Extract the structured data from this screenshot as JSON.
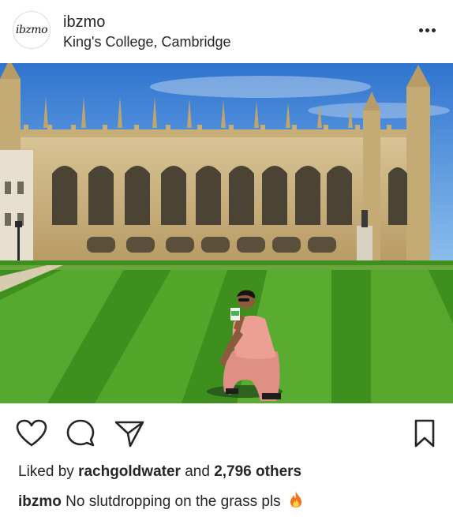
{
  "post": {
    "avatar_text": "ibzmo",
    "username": "ibzmo",
    "location": "King's College, Cambridge",
    "more_icon": "more-horizontal-icon"
  },
  "actions": {
    "like_icon": "heart-icon",
    "comment_icon": "comment-icon",
    "share_icon": "paper-plane-icon",
    "save_icon": "bookmark-icon"
  },
  "likes": {
    "prefix": "Liked by",
    "user": "rachgoldwater",
    "and": "and",
    "others": "2,796 others"
  },
  "caption": {
    "username": "ibzmo",
    "text": "No slutdropping on the grass pls",
    "emoji_icon": "fire-icon"
  },
  "colors": {
    "text": "#262626",
    "sky": "#3d82d6",
    "stone": "#c9b27e",
    "grass": "#3f8f1f",
    "shirt": "#e59a8f"
  }
}
